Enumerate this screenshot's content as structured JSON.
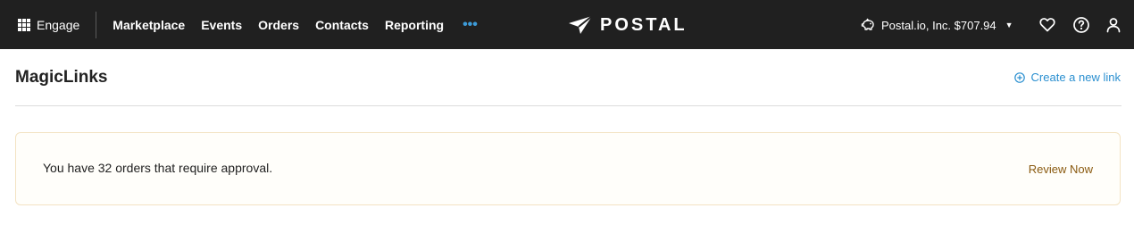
{
  "topbar": {
    "engage_label": "Engage",
    "nav_items": [
      "Marketplace",
      "Events",
      "Orders",
      "Contacts",
      "Reporting"
    ],
    "more_icon": "ellipsis-icon",
    "logo_text": "POSTAL",
    "account_label": "Postal.io, Inc. $707.94",
    "icons": [
      "grid-icon",
      "paper-plane-icon",
      "piggy-bank-icon",
      "chevron-down-icon",
      "heart-icon",
      "help-icon",
      "user-icon"
    ]
  },
  "page": {
    "title": "MagicLinks",
    "create_link_label": "Create a new link"
  },
  "banner": {
    "message": "You have 32 orders that require approval.",
    "action_label": "Review Now"
  },
  "colors": {
    "topbar_bg": "#202020",
    "accent": "#2a8fd0",
    "banner_border": "#f3e3c3",
    "banner_action": "#8a5a10"
  }
}
